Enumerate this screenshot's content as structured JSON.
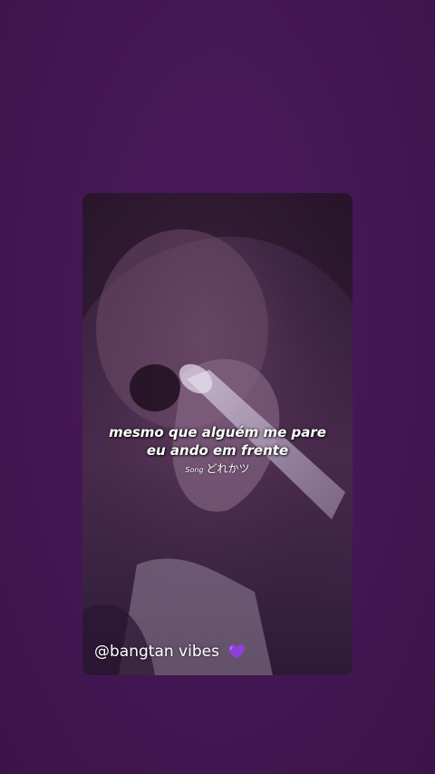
{
  "caption": {
    "line1": "mesmo que alguém me pare",
    "line2": "eu ando em frente",
    "song_label": "Song",
    "song_name": "どれかツ"
  },
  "watermark": {
    "handle": "@bangtan vibes",
    "icon": "purple-heart-icon"
  },
  "colors": {
    "background": "#421651",
    "heart": "#8e3fd6",
    "caption_text": "#ffffff"
  }
}
